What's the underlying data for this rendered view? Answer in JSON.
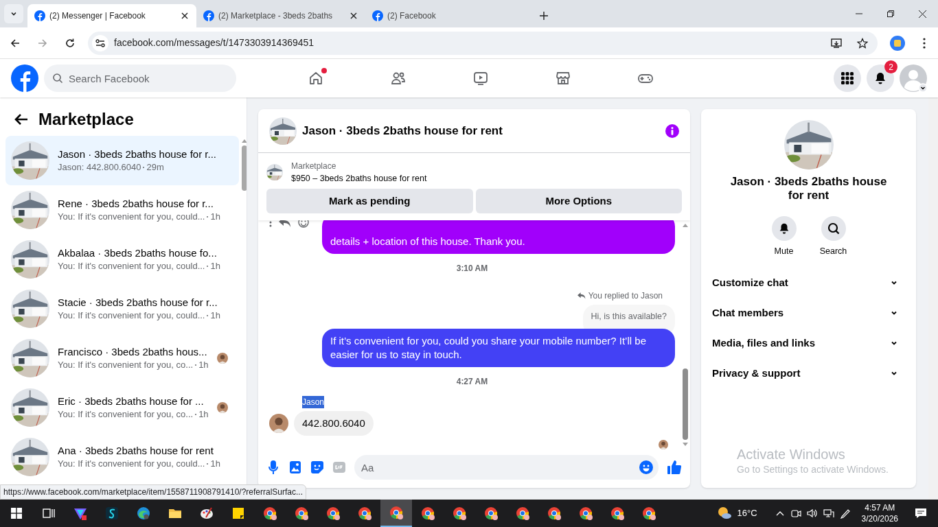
{
  "browser": {
    "tabs": [
      {
        "title": "(2) Messenger | Facebook",
        "selected": true,
        "closable": true
      },
      {
        "title": "(2) Marketplace - 3beds 2baths",
        "selected": false,
        "closable": true
      },
      {
        "title": "(2) Facebook",
        "selected": false,
        "closable": false
      }
    ],
    "url": "facebook.com/messages/t/1473303914369451",
    "status_url": "https://www.facebook.com/marketplace/item/1558711908791410/?referralSurfac..."
  },
  "topbar": {
    "search_placeholder": "Search Facebook",
    "nav": [
      {
        "kind": "home",
        "dot": true
      },
      {
        "kind": "friends",
        "dot": false
      },
      {
        "kind": "video",
        "dot": false
      },
      {
        "kind": "marketplace",
        "dot": false
      },
      {
        "kind": "gaming",
        "dot": false
      }
    ],
    "notification_count": "2"
  },
  "sidebar": {
    "title": "Marketplace",
    "chats": [
      {
        "name": "Jason · 3beds 2baths house for r...",
        "preview": "Jason: 442.800.6040",
        "time": "29m",
        "selected": true,
        "read_receipt": false
      },
      {
        "name": "Rene · 3beds 2baths house for r...",
        "preview": "You: If it's convenient for you, could...",
        "time": "1h",
        "selected": false,
        "read_receipt": false
      },
      {
        "name": "Akbalaa · 3beds 2baths house fo...",
        "preview": "You: If it's convenient for you, could...",
        "time": "1h",
        "selected": false,
        "read_receipt": false
      },
      {
        "name": "Stacie · 3beds 2baths house for r...",
        "preview": "You: If it's convenient for you, could...",
        "time": "1h",
        "selected": false,
        "read_receipt": false
      },
      {
        "name": "Francisco · 3beds 2baths hous...",
        "preview": "You: If it's convenient for you, co...",
        "time": "1h",
        "selected": false,
        "read_receipt": true
      },
      {
        "name": "Eric · 3beds 2baths house for ...",
        "preview": "You: If it's convenient for you, co...",
        "time": "1h",
        "selected": false,
        "read_receipt": true
      },
      {
        "name": "Ana · 3beds 2baths house for rent",
        "preview": "You: If it's convenient for you, could...",
        "time": "1h",
        "selected": false,
        "read_receipt": false
      }
    ]
  },
  "chat": {
    "title": "Jason · 3beds 2baths house for rent",
    "listing": {
      "label": "Marketplace",
      "title": "$950 – 3beds 2baths house for rent",
      "buttons": [
        "Mark as pending",
        "More Options"
      ]
    },
    "messages": [
      {
        "kind": "outgoing",
        "text": "details + location of this house. Thank you.",
        "color": "#a100fb"
      },
      {
        "kind": "time",
        "text": "3:10 AM"
      },
      {
        "kind": "reply_note",
        "text": "You replied to Jason"
      },
      {
        "kind": "quoted",
        "text": "Hi, is this available?"
      },
      {
        "kind": "outgoing",
        "text": "If it’s convenient for you, could you share your mobile number? It’ll be easier for us to stay in touch.",
        "color": "#4341f5"
      },
      {
        "kind": "time",
        "text": "4:27 AM"
      },
      {
        "kind": "sender",
        "text": "Jason"
      },
      {
        "kind": "incoming",
        "text": "442.800.6040"
      }
    ],
    "composer_placeholder": "Aa"
  },
  "details": {
    "title": "Jason · 3beds 2baths house for rent",
    "actions": [
      "Mute",
      "Search"
    ],
    "sections": [
      "Customize chat",
      "Chat members",
      "Media, files and links",
      "Privacy & support"
    ]
  },
  "activation": {
    "title": "Activate Windows",
    "subtitle": "Go to Settings to activate Windows."
  },
  "taskbar": {
    "apps": [
      {
        "kind": "taskview",
        "selected": false
      },
      {
        "kind": "triangle",
        "selected": false
      },
      {
        "kind": "s-app",
        "selected": false
      },
      {
        "kind": "edge",
        "selected": false
      },
      {
        "kind": "folder",
        "selected": false
      },
      {
        "kind": "paint",
        "selected": false
      },
      {
        "kind": "sticky",
        "selected": false
      },
      {
        "kind": "chrome",
        "selected": false
      },
      {
        "kind": "chrome",
        "selected": false
      },
      {
        "kind": "chrome",
        "selected": false
      },
      {
        "kind": "chrome",
        "selected": false
      },
      {
        "kind": "chrome",
        "selected": true
      },
      {
        "kind": "chrome",
        "selected": false
      },
      {
        "kind": "chrome",
        "selected": false
      },
      {
        "kind": "chrome",
        "selected": false
      },
      {
        "kind": "chrome",
        "selected": false
      },
      {
        "kind": "chrome",
        "selected": false
      },
      {
        "kind": "chrome",
        "selected": false
      },
      {
        "kind": "chrome",
        "selected": false
      },
      {
        "kind": "chrome",
        "selected": false
      }
    ],
    "temperature": "16°C",
    "time": "4:57 AM",
    "date": "3/20/2026"
  }
}
